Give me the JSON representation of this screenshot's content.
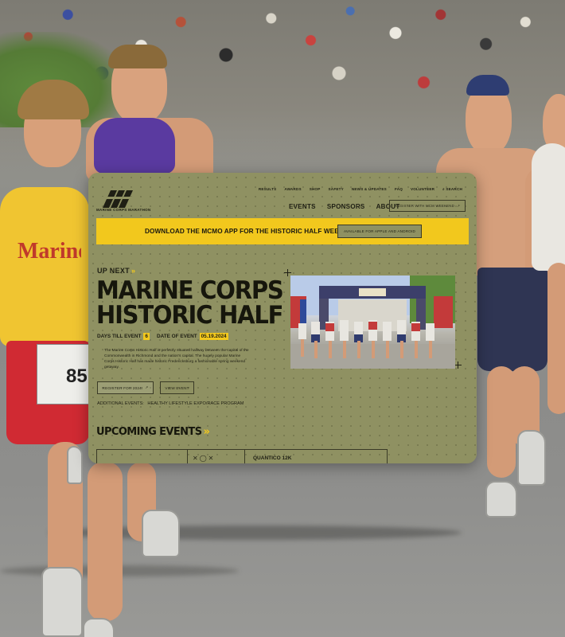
{
  "site": {
    "logo_label": "MARINE CORPS MARATHON",
    "top_nav": [
      "RESULTS",
      "AWARDS",
      "SHOP",
      "SAFETY",
      "NEWS & UPDATES",
      "FAQ",
      "VOLUNTEER",
      "SEARCH"
    ],
    "main_nav": [
      "EVENTS",
      "SPONSORS",
      "ABOUT"
    ],
    "register_button": "REGISTER WITH MCM WEEKEND"
  },
  "banner": {
    "text": "DOWNLOAD THE MCMO APP FOR THE HISTORIC HALF WEEKEND!",
    "button": "AVAILABLE FOR APPLE AND ANDROID"
  },
  "event": {
    "eyebrow": "UP NEXT",
    "title_line1": "MARINE CORPS",
    "title_line2": "HISTORIC HALF",
    "days_label": "DAYS TILL EVENT",
    "days_value": "6",
    "date_label": "DATE OF EVENT",
    "date_value": "05.19.2024",
    "description": "The Marine Corps Historic Half is perfectly situated halfway between the capital of the Commonwealth in Richmond and the nation's capital. The hugely popular Marine Corps Historic Half has made historic Fredericksburg a fashionable spring weekend getaway.",
    "register_button": "REGISTER FOR 2024!",
    "view_button": "VIEW EVENT",
    "additional_label": "ADDITIONAL EVENTS:",
    "additional_link": "HEALTHY LIFESTYLE EXPO/RACE PROGRAM"
  },
  "upcoming": {
    "heading": "UPCOMING EVENTS",
    "first_card_label": "QUANTICO 12K"
  },
  "colors": {
    "panel_olive": "#8f9162",
    "accent_yellow": "#f2c81d",
    "ink": "#1f1f14"
  }
}
